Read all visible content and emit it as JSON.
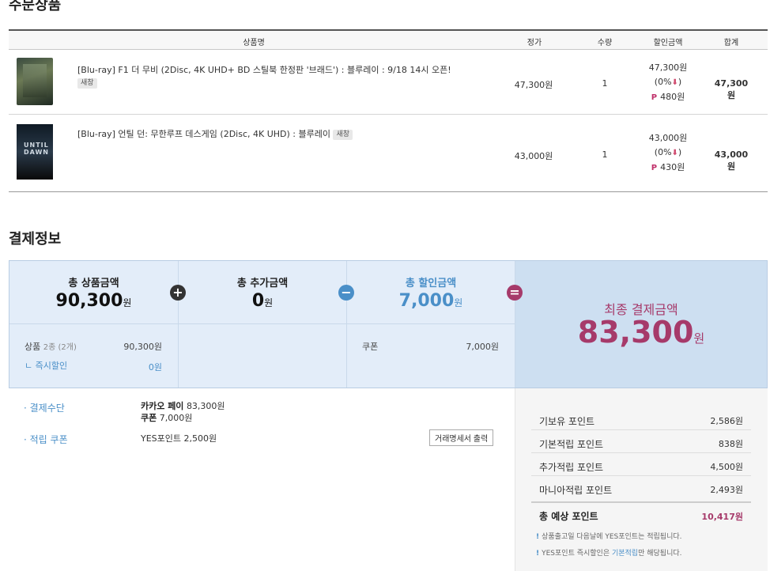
{
  "order": {
    "title": "주문상품",
    "headers": {
      "name": "상품명",
      "price": "정가",
      "qty": "수량",
      "discount": "할인금액",
      "total": "합계"
    },
    "items": [
      {
        "name": "[Blu-ray] F1 더 무비 (2Disc, 4K UHD+ BD 스틸북 한정판 '브래드') : 블루레이 : 9/18 14시 오픈!",
        "badge": "새창",
        "price": "47,300원",
        "qty": "1",
        "discount_amount": "47,300원",
        "discount_rate": "(0%",
        "discount_arrow": "⬇",
        "discount_close": ")",
        "point_symbol": "P",
        "points": "480원",
        "total": "47,300원"
      },
      {
        "name": "[Blu-ray] 언틸 던: 무한루프 데스게임 (2Disc, 4K UHD) : 블루레이",
        "badge": "새창",
        "thumb_text": "UNTIL DAWN",
        "price": "43,000원",
        "qty": "1",
        "discount_amount": "43,000원",
        "discount_rate": "(0%",
        "discount_arrow": "⬇",
        "discount_close": ")",
        "point_symbol": "P",
        "points": "430원",
        "total": "43,000원"
      }
    ]
  },
  "payment": {
    "title": "결제정보",
    "total_products_label": "총 상품금액",
    "total_products_value": "90,300",
    "total_extra_label": "총 추가금액",
    "total_extra_value": "0",
    "total_discount_label": "총 할인금액",
    "total_discount_value": "7,000",
    "currency": "원",
    "op_plus": "+",
    "op_minus": "−",
    "op_eq": "=",
    "final_label": "최종 결제금액",
    "final_value": "83,300",
    "products_line_label": "상품",
    "products_line_count": "2종 (2개)",
    "products_line_value": "90,300원",
    "instant_discount_label": "ㄴ 즉시할인",
    "instant_discount_value": "0원",
    "coupon_label": "쿠폰",
    "coupon_value": "7,000원"
  },
  "details": {
    "method_label": "· 결제수단",
    "method_line1_name": "카카오 페이",
    "method_line1_value": "83,300원",
    "method_line2_name": "쿠폰",
    "method_line2_value": "7,000원",
    "reward_label": "· 적립 쿠폰",
    "reward_value": "YES포인트 2,500원",
    "receipt_button": "거래명세서 출력"
  },
  "points": {
    "rows": [
      {
        "label": "기보유 포인트",
        "value": "2,586원"
      },
      {
        "label": "기본적립 포인트",
        "value": "838원"
      },
      {
        "label": "추가적립 포인트",
        "value": "4,500원"
      },
      {
        "label": "마니아적립 포인트",
        "value": "2,493원"
      }
    ],
    "total_label": "총 예상 포인트",
    "total_value": "10,417원",
    "note1": "상품출고일 다음날에 YES포인트는 적립됩니다.",
    "note2_pre": "YES포인트 즉시할인은 ",
    "note2_hl": "기본적립",
    "note2_post": "만 해당됩니다.",
    "note_mark": "!"
  },
  "colors": {
    "accent_blue": "#4a8fc8",
    "accent_plum": "#a63a6a",
    "panel_blue": "#e3edf9"
  }
}
